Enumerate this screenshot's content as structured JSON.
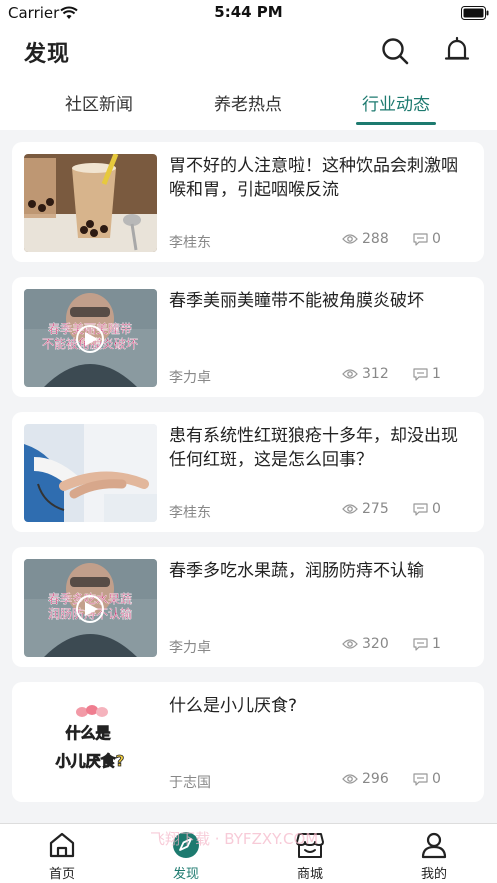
{
  "status_bar": {
    "carrier": "Carrier",
    "time": "5:44 PM"
  },
  "header": {
    "title": "发现"
  },
  "tabs": [
    {
      "label": "社区新闻",
      "active": false
    },
    {
      "label": "养老热点",
      "active": false
    },
    {
      "label": "行业动态",
      "active": true
    }
  ],
  "articles": [
    {
      "title": "胃不好的人注意啦！这种饮品会刺激咽喉和胃，引起咽喉反流",
      "author": "李桂东",
      "views": "288",
      "comments": "0",
      "thumb": "bubble-tea"
    },
    {
      "title": "春季美丽美瞳带不能被角膜炎破坏",
      "author": "李力卓",
      "views": "312",
      "comments": "1",
      "thumb": "video",
      "thumb_caption": [
        "春季美丽美瞳带",
        "不能被角膜炎破坏"
      ]
    },
    {
      "title": "患有系统性红斑狼疮十多年，却没出现任何红斑，这是怎么回事？",
      "author": "李桂东",
      "views": "275",
      "comments": "0",
      "thumb": "doctor"
    },
    {
      "title": "春季多吃水果蔬，润肠防痔不认输",
      "author": "李力卓",
      "views": "320",
      "comments": "1",
      "thumb": "video",
      "thumb_caption": [
        "春季多吃水果蔬",
        "润肠防痔不认输"
      ]
    },
    {
      "title": "什么是小儿厌食?",
      "author": "于志国",
      "views": "296",
      "comments": "0",
      "thumb": "text-graphic",
      "thumb_caption": [
        "什么是",
        "小儿厌食?"
      ]
    }
  ],
  "tabbar": [
    {
      "label": "首页",
      "icon": "home-icon",
      "active": false
    },
    {
      "label": "发现",
      "icon": "compass-icon",
      "active": true
    },
    {
      "label": "商城",
      "icon": "store-icon",
      "active": false
    },
    {
      "label": "我的",
      "icon": "person-icon",
      "active": false
    }
  ],
  "watermark": "飞翔下载 · BYFZXY.COM",
  "colors": {
    "accent": "#1d7a6f",
    "background": "#f3f4f6",
    "card": "#ffffff",
    "meta_text": "#888888"
  }
}
